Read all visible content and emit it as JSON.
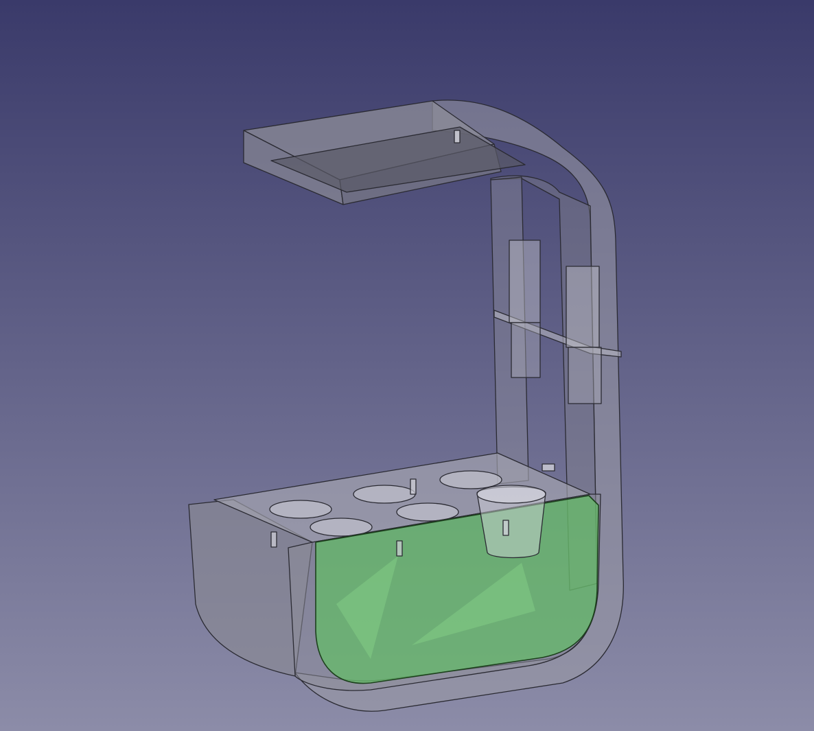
{
  "viewport": {
    "label": "",
    "background_top": "#3a3a6a",
    "background_bottom": "#8c8ca8"
  },
  "model": {
    "body_fill": "#9a9aa6",
    "edge_color": "#2a2a32",
    "reservoir_fill": "#5cc85c",
    "reservoir_edge": "#1c401c",
    "shelf_fill": "#8e8e98"
  }
}
